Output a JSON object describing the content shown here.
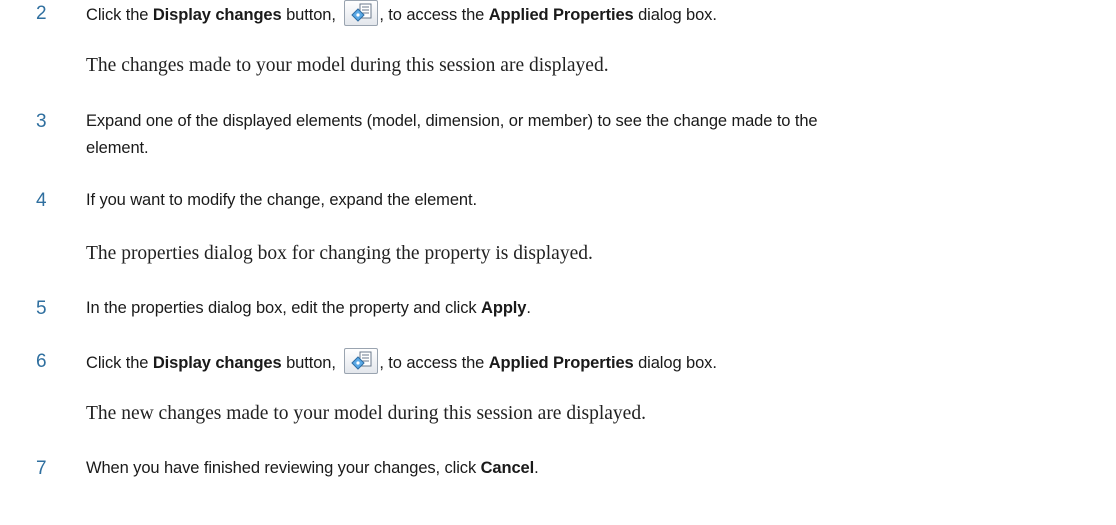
{
  "steps": [
    {
      "number": "2",
      "parts": {
        "a": "Click the ",
        "b": "Display changes",
        "c": " button, ",
        "d": ", to access the ",
        "e": "Applied Properties",
        "f": " dialog box."
      },
      "result": "The changes made to your model during this session are displayed."
    },
    {
      "number": "3",
      "line1": "Expand one of the displayed elements (model, dimension, or member) to see the change made to the",
      "line2": "element."
    },
    {
      "number": "4",
      "text": "If you want to modify the change, expand the element.",
      "result": "The properties dialog box for changing the property is displayed."
    },
    {
      "number": "5",
      "parts": {
        "a": "In the properties dialog box, edit the property and click ",
        "b": "Apply",
        "c": "."
      }
    },
    {
      "number": "6",
      "parts": {
        "a": "Click the ",
        "b": "Display changes",
        "c": " button, ",
        "d": ", to access the ",
        "e": "Applied Properties",
        "f": " dialog box."
      },
      "result": "The new changes made to your model during this session are displayed."
    },
    {
      "number": "7",
      "parts": {
        "a": "When you have finished reviewing your changes, click ",
        "b": "Cancel",
        "c": "."
      }
    }
  ],
  "icons": {
    "display_changes": "display-changes-icon"
  }
}
